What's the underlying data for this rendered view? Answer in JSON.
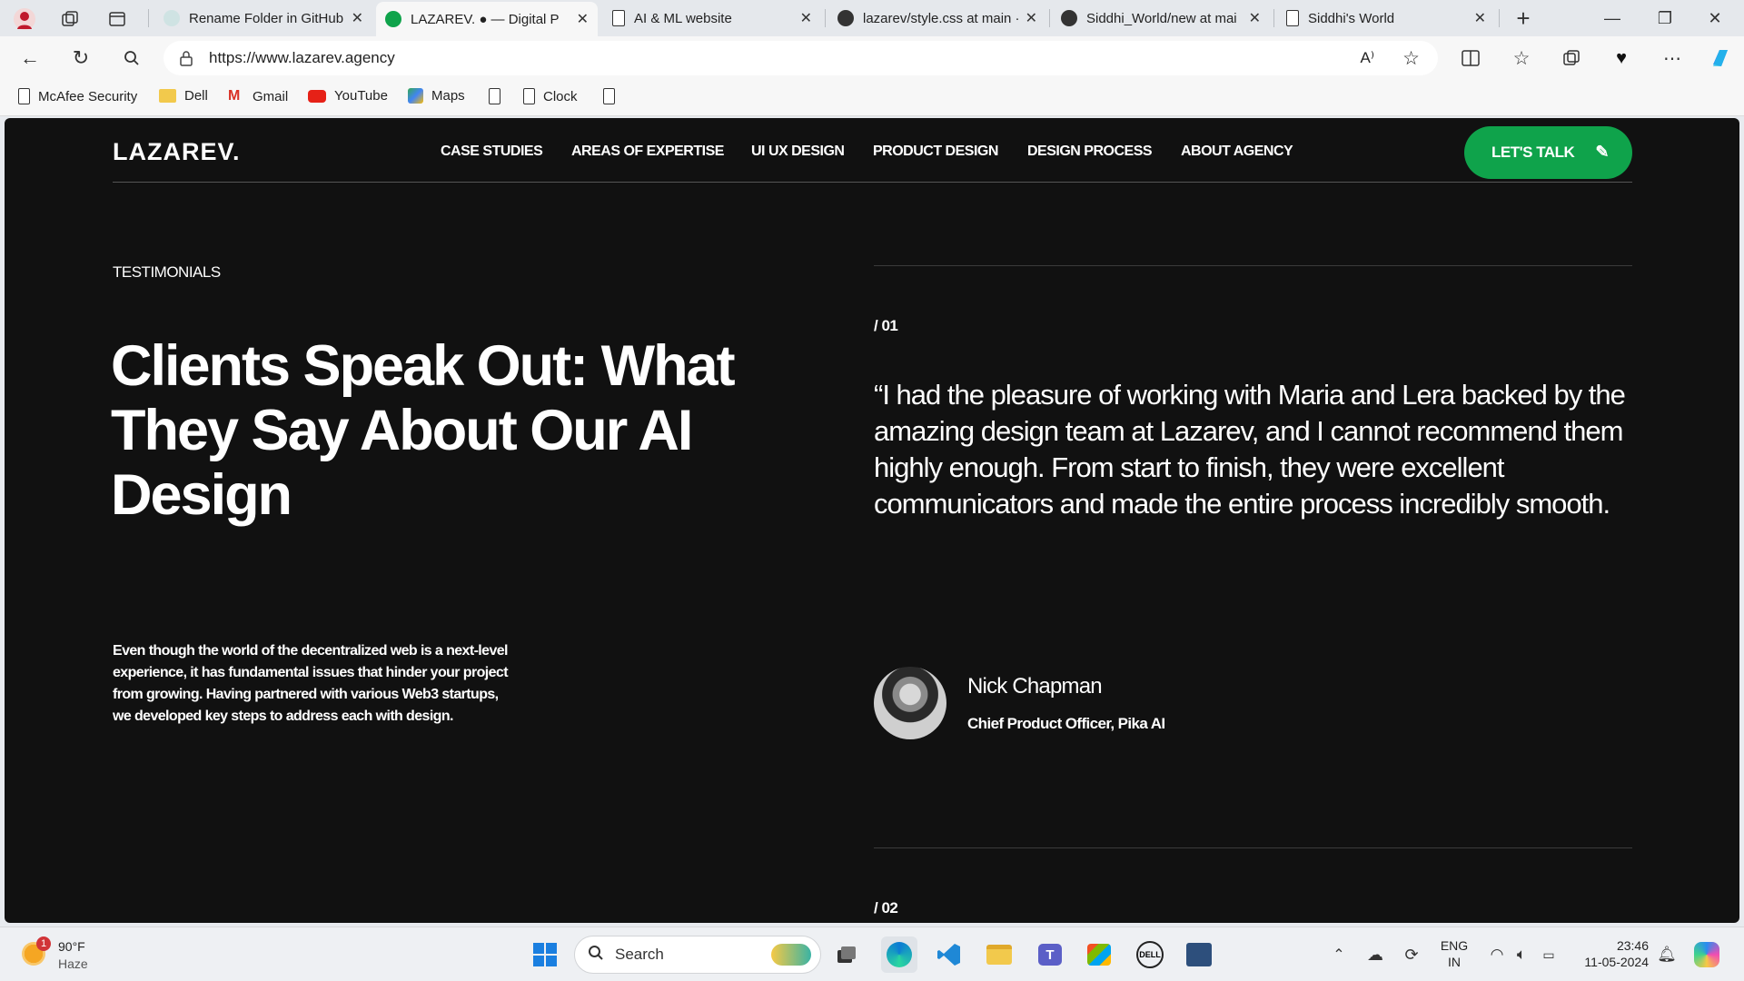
{
  "browser": {
    "tabs": [
      {
        "title": "Rename Folder in GitHub",
        "favicon": "page-icon"
      },
      {
        "title": "LAZAREV. ● — Digital P",
        "favicon": "lazarev-icon"
      },
      {
        "title": "AI & ML website",
        "favicon": "doc-icon"
      },
      {
        "title": "lazarev/style.css at main ·",
        "favicon": "github-icon"
      },
      {
        "title": "Siddhi_World/new at mai",
        "favicon": "github-icon"
      },
      {
        "title": "Siddhi's World",
        "favicon": "doc-icon"
      }
    ],
    "url": "https://www.lazarev.agency",
    "bookmarks": [
      "McAfee Security",
      "Dell",
      "Gmail",
      "YouTube",
      "Maps",
      "Clock"
    ]
  },
  "site": {
    "logo": "LAZAREV.",
    "nav": [
      "CASE STUDIES",
      "AREAS OF EXPERTISE",
      "UI UX DESIGN",
      "PRODUCT DESIGN",
      "DESIGN PROCESS",
      "ABOUT AGENCY"
    ],
    "cta": "LET'S TALK",
    "eyebrow": "TESTIMONIALS",
    "headline": "Clients Speak Out: What They Say About Our AI Design",
    "description": "Even though the world of the decentralized web is a next-level experience, it has fundamental issues that hinder your project from growing. Having partnered with various Web3 startups, we developed key steps to address each with design.",
    "testimonials": [
      {
        "number": "/ 01",
        "quote": "“I had the pleasure of working with Maria and Lera backed by the amazing design team at Lazarev, and I cannot recommend them highly enough. From start to finish, they were excellent communicators and made the entire process incredibly smooth.",
        "name": "Nick Chapman",
        "role": "Chief Product Officer, Pika AI"
      },
      {
        "number": "/ 02"
      }
    ],
    "accent": "#0fa34b"
  },
  "taskbar": {
    "weather_temp": "90°F",
    "weather_desc": "Haze",
    "weather_badge": "1",
    "search": "Search",
    "lang": "ENG",
    "region": "IN",
    "time": "23:46",
    "date": "11-05-2024"
  }
}
